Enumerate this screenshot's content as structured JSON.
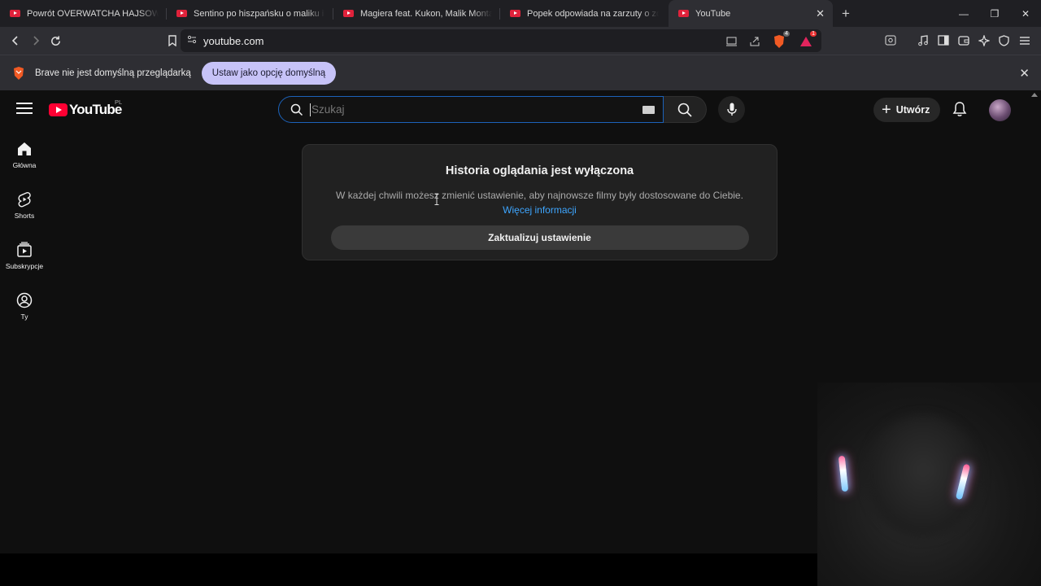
{
  "browser": {
    "tabs": [
      {
        "title": "Powrót OVERWATCHA HAJSOWNIKÓW",
        "active": false
      },
      {
        "title": "Sentino po hiszpańsku o maliku i Trum",
        "active": false
      },
      {
        "title": "Magiera feat. Kukon, Malik Montana",
        "active": false
      },
      {
        "title": "Popek odpowiada na zarzuty o zoofilię",
        "active": false
      },
      {
        "title": "YouTube",
        "active": true
      }
    ],
    "url": "youtube.com",
    "brave_shield_badge": "4",
    "rewards_badge": "1",
    "accent_color": "#c7c3f8"
  },
  "infobar": {
    "message": "Brave nie jest domyślną przeglądarką",
    "button_label": "Ustaw jako opcję domyślną"
  },
  "youtube": {
    "logo_text": "YouTube",
    "region": "PL",
    "search_placeholder": "Szukaj",
    "create_label": "Utwórz",
    "sidebar": [
      {
        "label": "Główna",
        "icon": "home-icon"
      },
      {
        "label": "Shorts",
        "icon": "shorts-icon"
      },
      {
        "label": "Subskrypcje",
        "icon": "subscriptions-icon"
      },
      {
        "label": "Ty",
        "icon": "you-icon"
      }
    ],
    "history_card": {
      "title": "Historia oglądania jest wyłączona",
      "description": "W każdej chwili możesz zmienić ustawienie, aby najnowsze filmy były dostosowane do Ciebie.",
      "more_link": "Więcej informacji",
      "button_label": "Zaktualizuj ustawienie"
    },
    "brand_color": "#ff0033",
    "link_color": "#3ea6ff"
  }
}
